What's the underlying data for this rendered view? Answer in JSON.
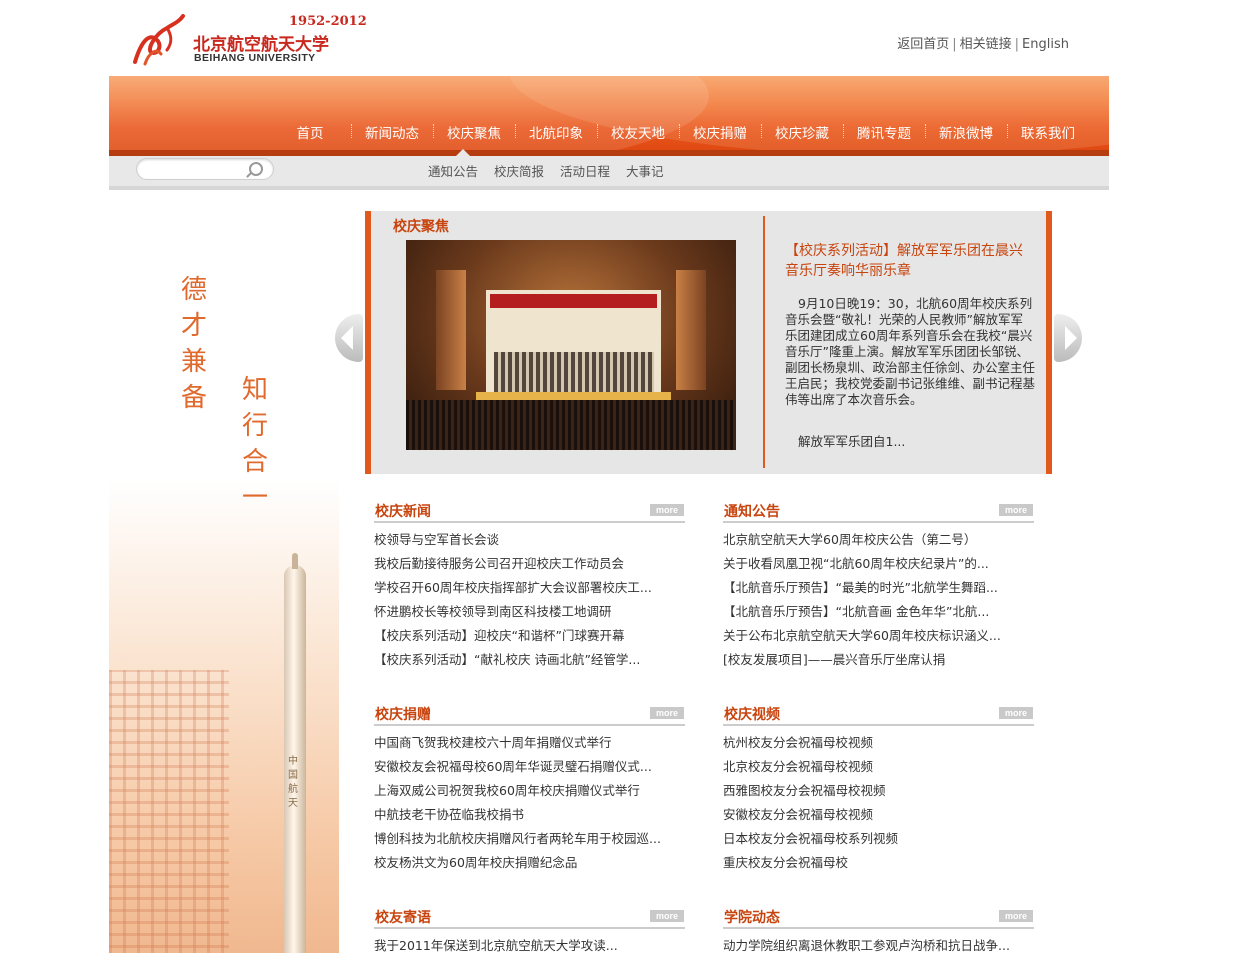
{
  "header": {
    "logo": {
      "years": "1952-2012",
      "name_cn": "北京航空航天大学",
      "name_en": "BEIHANG UNIVERSITY"
    },
    "top_links": [
      "返回首页",
      "相关链接",
      "English"
    ]
  },
  "nav": {
    "items": [
      "首页",
      "新闻动态",
      "校庆聚焦",
      "北航印象",
      "校友天地",
      "校庆捐赠",
      "校庆珍藏",
      "腾讯专题",
      "新浪微博",
      "联系我们"
    ],
    "active": "校庆聚焦"
  },
  "search": {
    "placeholder": ""
  },
  "subnav": {
    "items": [
      "通知公告",
      "校庆简报",
      "活动日程",
      "大事记"
    ]
  },
  "motto": {
    "line1": "德才兼备",
    "line2": "知行合一"
  },
  "rocket_text": "中国航天",
  "focus": {
    "title": "校庆聚焦",
    "headline": "【校庆系列活动】解放军军乐团在晨兴音乐厅奏响华丽乐章",
    "summary": "9月10日晚19：30，北航60周年校庆系列音乐会暨“敬礼！光荣的人民教师”解放军军乐团建团成立60周年系列音乐会在我校“晨兴音乐厅”隆重上演。解放军军乐团团长邹锐、副团长杨泉圳、政治部主任徐剑、办公室主任王启民；我校党委副书记张维维、副书记程基伟等出席了本次音乐会。",
    "more_text": "解放军军乐团自1...",
    "photo_banner": "热烈祝贺北航60周年校庆"
  },
  "sections": [
    {
      "title": "校庆新闻",
      "more": "more",
      "items": [
        "校领导与空军首长会谈",
        "我校后勤接待服务公司召开迎校庆工作动员会",
        "学校召开60周年校庆指挥部扩大会议部署校庆工...",
        "怀进鹏校长等校领导到南区科技楼工地调研",
        "【校庆系列活动】迎校庆“和谐杯”门球赛开幕",
        "【校庆系列活动】“献礼校庆 诗画北航”经管学..."
      ]
    },
    {
      "title": "通知公告",
      "more": "more",
      "items": [
        "北京航空航天大学60周年校庆公告（第二号）",
        "关于收看凤凰卫视“北航60周年校庆纪录片”的...",
        "【北航音乐厅预告】“最美的时光”北航学生舞蹈...",
        "【北航音乐厅预告】“北航音画 金色年华”北航...",
        "关于公布北京航空航天大学60周年校庆标识涵义...",
        "[校友发展项目]——晨兴音乐厅坐席认捐"
      ]
    },
    {
      "title": "校庆捐赠",
      "more": "more",
      "items": [
        "中国商飞贺我校建校六十周年捐赠仪式举行",
        "安徽校友会祝福母校60周年华诞灵璧石捐赠仪式...",
        "上海双威公司祝贺我校60周年校庆捐赠仪式举行",
        "中航技老干协莅临我校捐书",
        "博创科技为北航校庆捐赠风行者两轮车用于校园巡...",
        "校友杨洪文为60周年校庆捐赠纪念品"
      ]
    },
    {
      "title": "校庆视频",
      "more": "more",
      "items": [
        "杭州校友分会祝福母校视频",
        "北京校友分会祝福母校视频",
        "西雅图校友分会祝福母校视频",
        "安徽校友分会祝福母校视频",
        "日本校友分会祝福母校系列视频",
        "重庆校友分会祝福母校"
      ]
    },
    {
      "title": "校友寄语",
      "more": "more",
      "items": [
        "我于2011年保送到北京航空航天大学攻读..."
      ]
    },
    {
      "title": "学院动态",
      "more": "more",
      "items": [
        "动力学院组织离退休教职工参观卢沟桥和抗日战争..."
      ]
    }
  ]
}
